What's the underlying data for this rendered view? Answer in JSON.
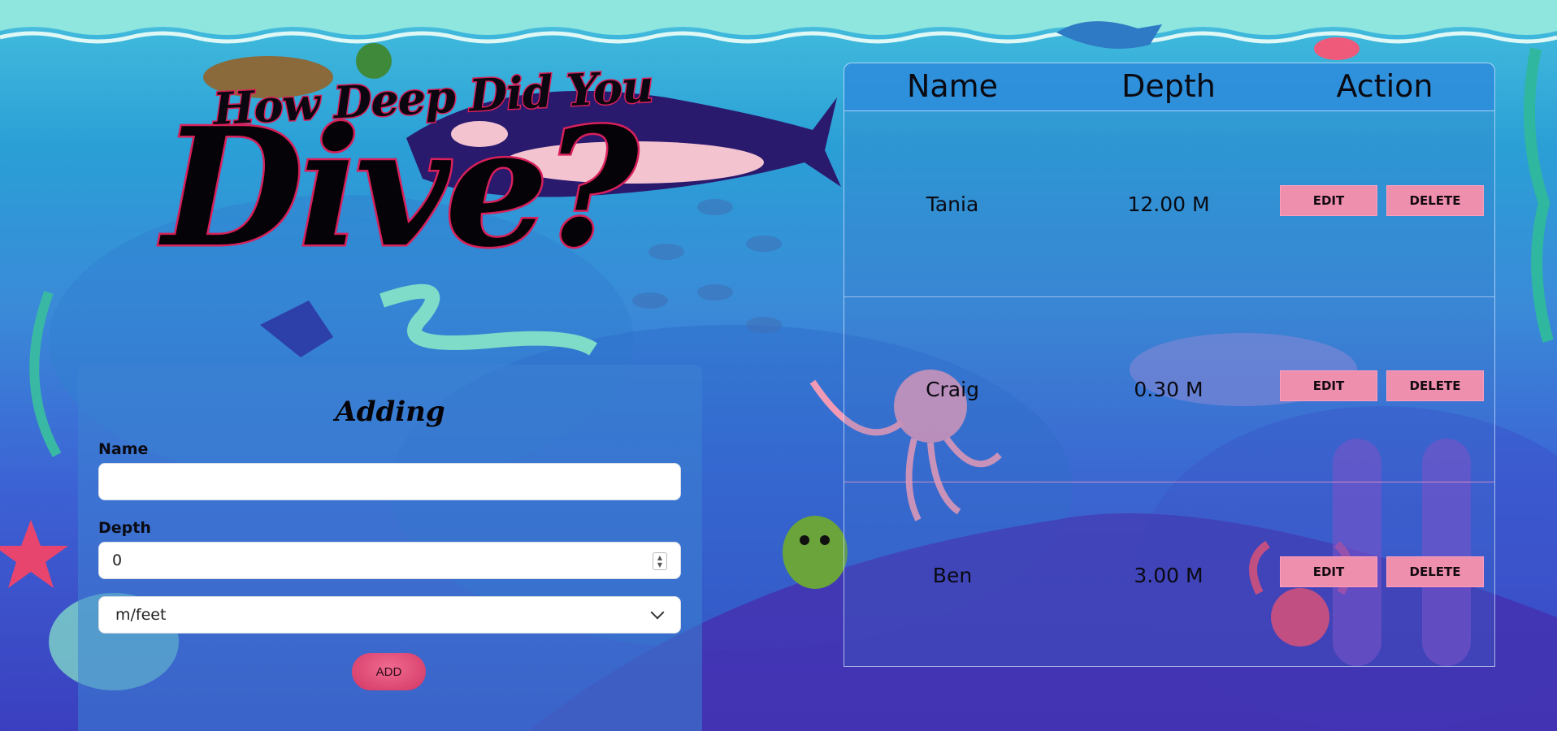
{
  "title": {
    "line1": "How Deep Did You",
    "line2": "Dive?"
  },
  "form": {
    "heading": "Adding",
    "name_label": "Name",
    "name_value": "",
    "depth_label": "Depth",
    "depth_value": "0",
    "unit_selected": "m/feet",
    "add_label": "ADD"
  },
  "table": {
    "headers": [
      "Name",
      "Depth",
      "Action"
    ],
    "rows": [
      {
        "name": "Tania",
        "depth": "12.00 M",
        "edit": "EDIT",
        "delete": "DELETE"
      },
      {
        "name": "Craig",
        "depth": "0.30 M",
        "edit": "EDIT",
        "delete": "DELETE"
      },
      {
        "name": "Ben",
        "depth": "3.00 M",
        "edit": "EDIT",
        "delete": "DELETE"
      }
    ]
  },
  "colors": {
    "accent_pink": "#ef8fae",
    "title_outline": "#d8205a",
    "add_button": "#d23764"
  }
}
